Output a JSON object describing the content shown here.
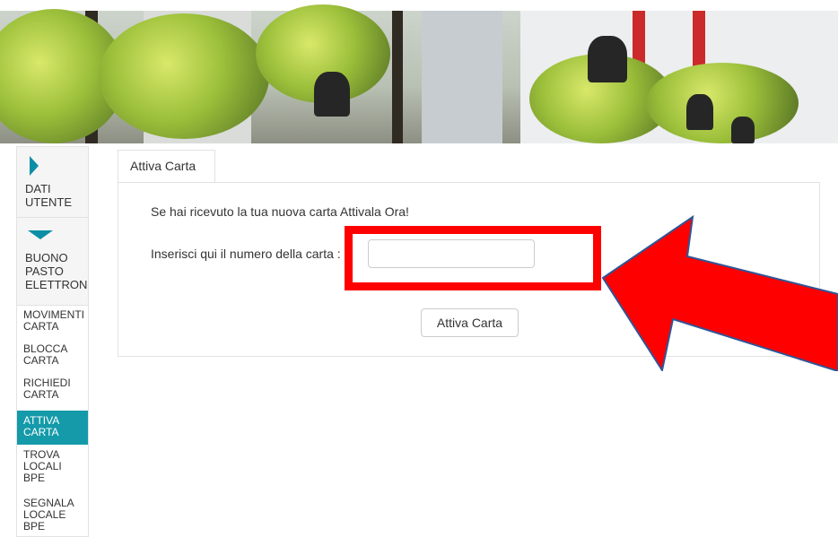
{
  "sidebar": {
    "sections": [
      {
        "label": "DATI\nUTENTE",
        "icon": "chevron-right-icon"
      },
      {
        "label": "BUONO\nPASTO\nELETTRONICO",
        "icon": "chevron-down-icon"
      }
    ],
    "items": [
      {
        "label": "MOVIMENTI\nCARTA",
        "active": false
      },
      {
        "label": "BLOCCA\nCARTA",
        "active": false
      },
      {
        "label": "RICHIEDI\nCARTA",
        "active": false
      },
      {
        "label": "ATTIVA\nCARTA",
        "active": true
      },
      {
        "label": "TROVA\nLOCALI\nBPE",
        "active": false
      },
      {
        "label": "SEGNALA\nLOCALE\nBPE",
        "active": false
      }
    ]
  },
  "main": {
    "tab_label": "Attiva Carta",
    "message": "Se hai ricevuto la tua nuova carta Attivala Ora!",
    "input_label": "Inserisci qui il numero della carta :",
    "input_value": "",
    "input_placeholder": "",
    "submit_label": "Attiva Carta"
  },
  "colors": {
    "accent": "#149aa9",
    "annotation": "#ff0000"
  }
}
